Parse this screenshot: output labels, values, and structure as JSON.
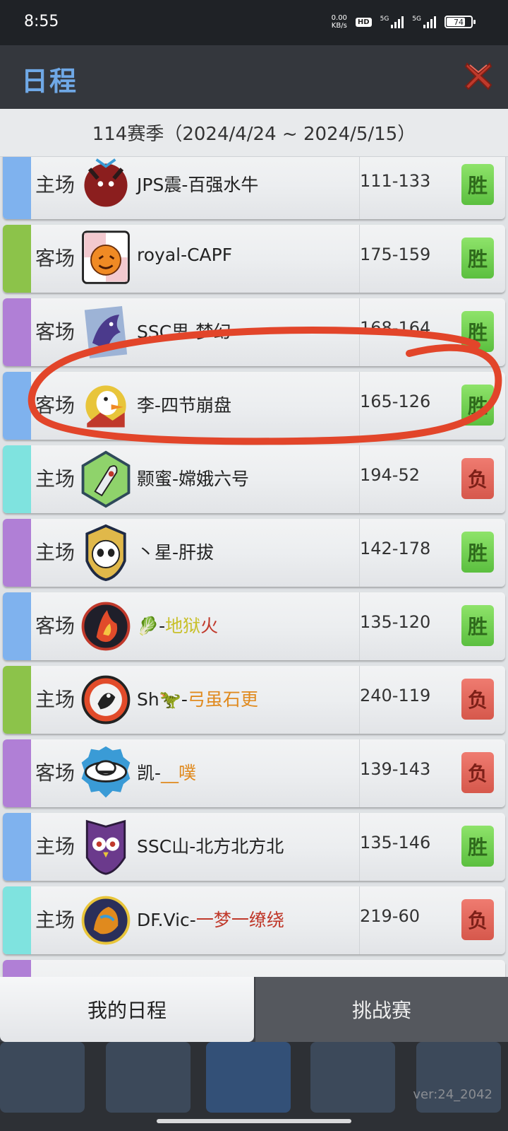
{
  "status": {
    "time": "8:55",
    "net_speed": "0.00",
    "net_unit": "KB/s",
    "hd": "HD",
    "sig1": "5G",
    "sig2": "5G",
    "battery": "74"
  },
  "header": {
    "title": "日程"
  },
  "season": {
    "label": "114赛季（2024/4/24 ~ 2024/5/15）"
  },
  "colors": {
    "blue": "#7fb2ee",
    "green": "#8cc34a",
    "purple": "#b07fd6",
    "cyan": "#7fe3df",
    "win": "#6fd14c",
    "lose": "#e0675c",
    "annotation": "#e2452a"
  },
  "matches": [
    {
      "venue": "主场",
      "team": "JPS震-百强水牛",
      "score": "111-133",
      "result": "胜",
      "stripe": "blue",
      "logo": "bison-icon"
    },
    {
      "venue": "客场",
      "team": "royal-CAPF",
      "score": "175-159",
      "result": "胜",
      "stripe": "green",
      "logo": "pumpkin-icon"
    },
    {
      "venue": "客场",
      "team": "SSC思-梦幻",
      "score": "168-164",
      "result": "胜",
      "stripe": "purple",
      "logo": "griffin-icon"
    },
    {
      "venue": "客场",
      "team": "李-四节崩盘",
      "score": "165-126",
      "result": "胜",
      "stripe": "blue",
      "logo": "duck-icon"
    },
    {
      "venue": "主场",
      "team": "颢蜜-嫦娥六号",
      "score": "194-52",
      "result": "负",
      "stripe": "cyan",
      "logo": "rocket-icon"
    },
    {
      "venue": "主场",
      "team": "丶星-肝拔",
      "score": "142-178",
      "result": "胜",
      "stripe": "purple",
      "logo": "panda-icon"
    },
    {
      "venue": "客场",
      "team_prefix": "🥬-",
      "team_hl": "地狱",
      "team_red": "火",
      "score": "135-120",
      "result": "胜",
      "stripe": "blue",
      "logo": "fire-icon"
    },
    {
      "venue": "主场",
      "team_prefix": "Sh🦖-",
      "team_hl": "弓虽石更",
      "score": "240-119",
      "result": "负",
      "stripe": "green",
      "logo": "duck-fire-icon"
    },
    {
      "venue": "客场",
      "team_prefix": "凯-",
      "team_hl": "__噗",
      "score": "139-143",
      "result": "负",
      "stripe": "purple",
      "logo": "ufo-icon"
    },
    {
      "venue": "主场",
      "team": "SSC山-北方北方北",
      "score": "135-146",
      "result": "胜",
      "stripe": "blue",
      "logo": "owl-icon"
    },
    {
      "venue": "主场",
      "team_prefix": "DF.Vic-",
      "team_red": "一梦一缭绕",
      "score": "219-60",
      "result": "负",
      "stripe": "cyan",
      "logo": "lion-icon"
    }
  ],
  "tabs": {
    "mine": "我的日程",
    "challenge": "挑战赛"
  },
  "version": "ver:24_2042"
}
